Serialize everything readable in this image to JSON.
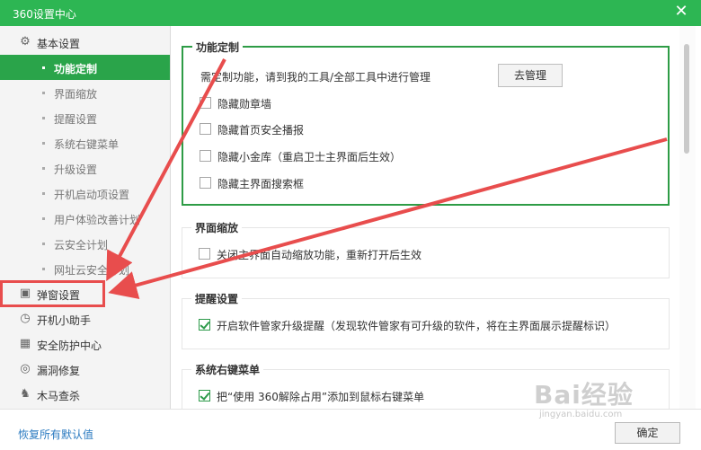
{
  "window": {
    "title": "360设置中心",
    "close_icon": "close-icon"
  },
  "sidebar": {
    "groups": [
      {
        "label": "基本设置",
        "icon": "gear-icon"
      },
      {
        "label": "弹窗设置",
        "icon": "window-icon"
      },
      {
        "label": "开机小助手",
        "icon": "clock-icon"
      },
      {
        "label": "安全防护中心",
        "icon": "grid-icon"
      },
      {
        "label": "漏洞修复",
        "icon": "patch-icon"
      },
      {
        "label": "木马查杀",
        "icon": "horse-icon"
      }
    ],
    "sub_items": [
      {
        "label": "功能定制"
      },
      {
        "label": "界面缩放"
      },
      {
        "label": "提醒设置"
      },
      {
        "label": "系统右键菜单"
      },
      {
        "label": "升级设置"
      },
      {
        "label": "开机启动项设置"
      },
      {
        "label": "用户体验改善计划"
      },
      {
        "label": "云安全计划"
      },
      {
        "label": "网址云安全计划"
      }
    ],
    "active_item": "功能定制"
  },
  "content": {
    "sections": [
      {
        "title": "功能定制",
        "description": "需定制功能，请到我的工具/全部工具中进行管理",
        "manage_button": "去管理",
        "options": [
          {
            "label": "隐藏勋章墙",
            "checked": false
          },
          {
            "label": "隐藏首页安全播报",
            "checked": false
          },
          {
            "label": "隐藏小金库（重启卫士主界面后生效）",
            "checked": false
          },
          {
            "label": "隐藏主界面搜索框",
            "checked": false
          }
        ]
      },
      {
        "title": "界面缩放",
        "options": [
          {
            "label": "关闭主界面自动缩放功能，重新打开后生效",
            "checked": false
          }
        ]
      },
      {
        "title": "提醒设置",
        "options": [
          {
            "label": "开启软件管家升级提醒（发现软件管家有可升级的软件，将在主界面展示提醒标识）",
            "checked": true
          }
        ]
      },
      {
        "title": "系统右键菜单",
        "options": [
          {
            "label": "把“使用 360解除占用”添加到鼠标右键菜单",
            "checked": true
          }
        ]
      }
    ]
  },
  "footer": {
    "restore_link": "恢复所有默认值",
    "ok_button": "确定"
  },
  "watermark": {
    "logo": "Bai经验",
    "url": "jingyan.baidu.com"
  },
  "colors": {
    "brand_green": "#2db653",
    "active_green": "#2aa44a",
    "annotation_red": "#e84d4d"
  }
}
